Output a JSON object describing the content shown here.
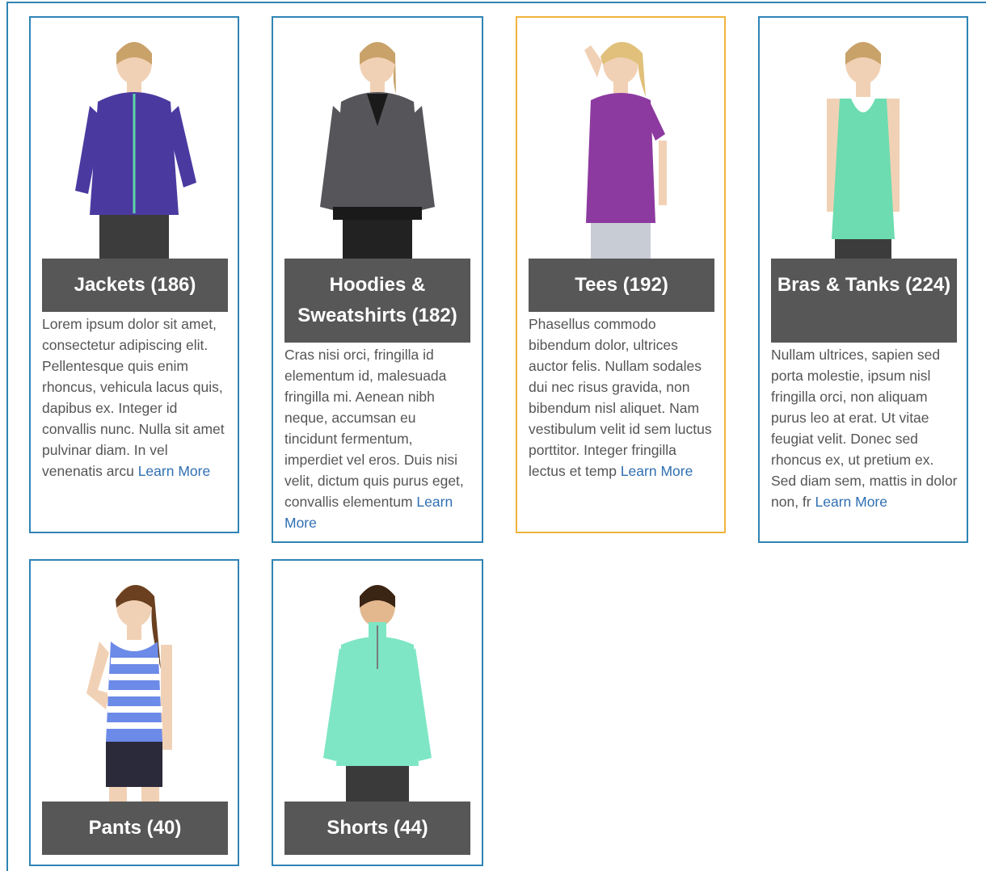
{
  "categories": [
    {
      "title": "Jackets (186)",
      "description": "Lorem ipsum dolor sit amet, consectetur adipiscing elit. Pellentesque quis enim rhoncus, vehicula lacus quis, dapibus ex. Integer id convallis nunc. Nulla sit amet pulvinar diam. In vel venenatis arcu",
      "link": "Learn More",
      "garment_color": "#4a3aa0",
      "bottom_color": "#3c3c3c"
    },
    {
      "title": "Hoodies & Sweatshirts (182)",
      "description": "Cras nisi orci, fringilla id elementum id, malesuada fringilla mi. Aenean nibh neque, accumsan eu tincidunt fermentum, imperdiet vel eros. Duis nisi velit, dictum quis purus eget, convallis elementum",
      "link": "Learn More",
      "garment_color": "#55555a",
      "bottom_color": "#222222"
    },
    {
      "title": "Tees (192)",
      "description": "Phasellus commodo bibendum dolor, ultrices auctor felis. Nullam sodales dui nec risus gravida, non bibendum nisl aliquet. Nam vestibulum velit id sem luctus porttitor. Integer fringilla lectus et temp",
      "link": "Learn More",
      "garment_color": "#8c3aa0",
      "bottom_color": "#c8ccd4"
    },
    {
      "title": "Bras & Tanks (224)",
      "description": "Nullam ultrices, sapien sed porta molestie, ipsum nisl fringilla orci, non aliquam purus leo at erat. Ut vitae feugiat velit. Donec sed rhoncus ex, ut pretium ex. Sed diam sem, mattis in dolor non, fr",
      "link": "Learn More",
      "garment_color": "#6ddcb0",
      "bottom_color": "#3c3c3c"
    },
    {
      "title": "Pants (40)",
      "garment_color": "#6c8ae8",
      "bottom_color": "#2a2a3a"
    },
    {
      "title": "Shorts (44)",
      "garment_color": "#7ee6c4",
      "bottom_color": "#3a3a3a"
    }
  ],
  "colors": {
    "card_border": "#2f84b5",
    "highlight_border": "#f0b43c",
    "title_bar": "#575757",
    "link": "#2f6fb2"
  }
}
